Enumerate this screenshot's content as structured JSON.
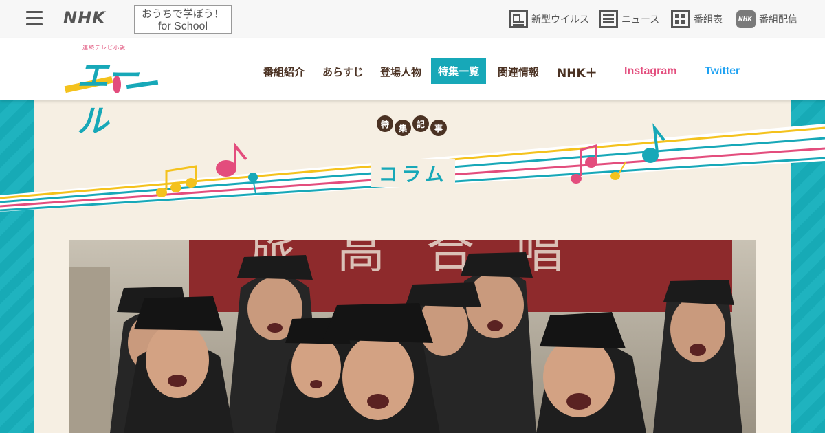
{
  "topbar": {
    "logo": "NHK",
    "school_line1": "おうちで学ぼう！",
    "school_line2": "for School",
    "links": [
      {
        "label": "新型ウイルス",
        "icon": "document-icon"
      },
      {
        "label": "ニュース",
        "icon": "news-icon"
      },
      {
        "label": "番組表",
        "icon": "grid-icon"
      },
      {
        "label": "番組配信",
        "icon": "nhk-plus-icon"
      }
    ]
  },
  "program": {
    "logo_sub": "連続テレビ小説",
    "logo_title": "エール",
    "nav": [
      {
        "label": "番組紹介"
      },
      {
        "label": "あらすじ"
      },
      {
        "label": "登場人物"
      },
      {
        "label": "特集一覧",
        "active": true
      },
      {
        "label": "関連情報"
      },
      {
        "label": "NHK＋"
      },
      {
        "label": "Instagram"
      },
      {
        "label": "Twitter"
      }
    ]
  },
  "feature": {
    "badges": [
      "特",
      "集",
      "記",
      "事"
    ],
    "title": "コラム"
  },
  "photo": {
    "banner_text": "旅高合唱",
    "subject": "group-of-students-singing"
  },
  "colors": {
    "teal": "#17a8b8",
    "pink": "#e34d7d",
    "yellow": "#f4c21d",
    "brown": "#4b3223",
    "cream": "#f6efe3"
  }
}
